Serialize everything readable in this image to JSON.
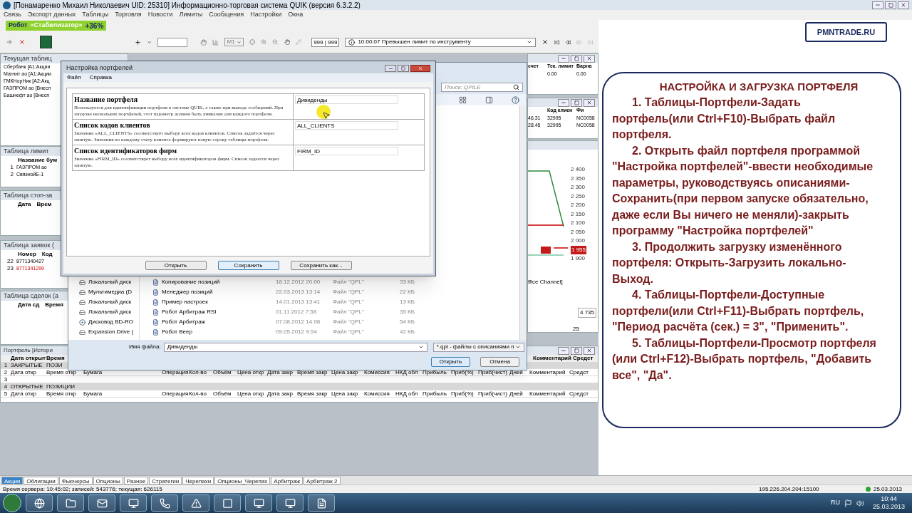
{
  "window": {
    "title": "[Понамаренко Михаил Николаевич  UID: 25310] Информационно-торговая система QUIK (версия 6.3.2.2)"
  },
  "menu": [
    "Связь",
    "Экспорт данных",
    "Таблицы",
    "Торговля",
    "Новости",
    "Лимиты",
    "Сообщения",
    "Настройки",
    "Окна"
  ],
  "robot_banner": {
    "label": "Робот",
    "name": "«Стабилизатор»",
    "gain": "+36%"
  },
  "toolbar": {
    "timeframe": "M1",
    "counter": "999 | 999",
    "message": "10:00:07  Превышен лимит по инструменту"
  },
  "site_badge": "PMNTRADE.RU",
  "instructions": {
    "title": "НАСТРОЙКА И ЗАГРУЗКА ПОРТФЕЛЯ",
    "steps": [
      "1. Таблицы-Портфели-Задать портфель(или Ctrl+F10)-Выбрать файл портфеля.",
      "2. Открыть файл портфеля программой \"Настройка портфелей\"-ввести необходимые параметры, руководствуясь описаниями- Сохранить(при первом запуске обязательно, даже если Вы ничего не меняли)-закрыть программу \"Настройка портфелей\"",
      "3. Продолжить загрузку изменённого портфеля: Открыть-Загрузить локально-Выход.",
      "4. Таблицы-Портфели-Доступные портфели(или Ctrl+F11)-Выбрать портфель, \"Период расчёта (сек.) = 3\", \"Применить\".",
      "5. Таблицы-Портфели-Просмотр портфеля (или Ctrl+F12)-Выбрать портфель, \"Добавить все\", \"Да\"."
    ]
  },
  "left_windows": [
    {
      "title": "Текущая таблиц",
      "rows": [
        {
          "cells": [
            "Сбербанк [A1:Акции"
          ],
          "alert": false
        },
        {
          "cells": [
            "Магнит ао [A1:Акции"
          ],
          "alert": false
        },
        {
          "cells": [
            "ГМКНорНик [A2:Акц"
          ],
          "alert": false
        },
        {
          "cells": [
            "ГАЗПРОМ ао [Внесп"
          ],
          "alert": false
        },
        {
          "cells": [
            "Башнефт ао [Внесп"
          ],
          "alert": false
        }
      ]
    },
    {
      "title": "Таблица лимит",
      "columns": [
        "Название бум"
      ],
      "rows": [
        {
          "num": "1",
          "cells": [
            "ГАЗПРОМ ао"
          ],
          "alert": false
        },
        {
          "num": "2",
          "cells": [
            "СвязнойБ-1"
          ],
          "alert": false
        }
      ]
    },
    {
      "title": "Таблица стоп-за",
      "columns": [
        "Дата",
        "Врем"
      ]
    },
    {
      "title": "Таблица заявок (",
      "columns": [
        "Номер",
        "Код"
      ],
      "rows": [
        {
          "num": "22",
          "cells": [
            "8771340427"
          ],
          "alert": false
        },
        {
          "num": "23",
          "cells": [
            "8771341299"
          ],
          "alert": true
        }
      ]
    },
    {
      "title": "Таблица сделок (а",
      "columns": [
        "Дата сд",
        "Время"
      ]
    }
  ],
  "right_windows": [
    {
      "columns": [
        "счет",
        "Тек. лимит",
        "Варна"
      ],
      "rows": [
        [
          "",
          "0.00",
          "0.00"
        ]
      ]
    },
    {
      "columns": [
        "",
        "Код клиен",
        "Фи"
      ],
      "rows": [
        [
          "46.31",
          "32995",
          "NC0058"
        ],
        [
          "28.45",
          "32995",
          "NC0058"
        ]
      ]
    }
  ],
  "price_chart": {
    "scale": [
      {
        "label": "2 400",
        "current": false
      },
      {
        "label": "2 350",
        "current": false
      },
      {
        "label": "2 300",
        "current": false
      },
      {
        "label": "2 250",
        "current": false
      },
      {
        "label": "2 200",
        "current": false
      },
      {
        "label": "2 150",
        "current": false
      },
      {
        "label": "2 100",
        "current": false
      },
      {
        "label": "2 050",
        "current": false
      },
      {
        "label": "2 000",
        "current": false
      },
      {
        "label": "1 955",
        "current": true
      },
      {
        "label": "1 900",
        "current": false
      }
    ],
    "caption": "ffice Channel]",
    "reading": "4 735",
    "count": "25"
  },
  "file_dialog": {
    "search_placeholder": "Поиск: QPILE",
    "nav": [
      "Локальный диск",
      "Мультимедиа (D",
      "Локальный диск",
      "Локальный диск",
      "Дисковод BD-RO",
      "Expansion Drive ("
    ],
    "files": [
      {
        "name": "Копирование позиций",
        "date": "18.12.2012 20:00",
        "type": "Файл \"QPL\"",
        "size": "33 КБ"
      },
      {
        "name": "Менеджер позиций",
        "date": "22.03.2013 13:14",
        "type": "Файл \"QPL\"",
        "size": "22 КБ"
      },
      {
        "name": "Пример настроек",
        "date": "14.01.2013 13:41",
        "type": "Файл \"QPL\"",
        "size": "13 КБ"
      },
      {
        "name": "Робот Арбитраж RSI",
        "date": "01.11.2012 7:58",
        "type": "Файл \"QPL\"",
        "size": "35 КБ"
      },
      {
        "name": "Робот Арбитраж",
        "date": "07.08.2012 14:08",
        "type": "Файл \"QPL\"",
        "size": "54 КБ"
      },
      {
        "name": "Робот Веер",
        "date": "09.05.2012 9:54",
        "type": "Файл \"QPL\"",
        "size": "42 КБ"
      }
    ],
    "filename_label": "Имя файла:",
    "filename": "Дивиденды",
    "filter": "*.qpl - файлы с описаниями п",
    "buttons": [
      {
        "label": "Открыть",
        "default": true
      },
      {
        "label": "Отмена",
        "default": false
      }
    ]
  },
  "settings_dialog": {
    "title": "Настройка портфелей",
    "menu": [
      "Файл",
      "Справка"
    ],
    "params": [
      {
        "name": "Название портфеля",
        "description": "Используется для идентификации портфеля в системе QUIK, а также при выводе сообщений. При загрузке нескольких портфелей, этот параметр должен быть уникален для каждого портфеля.",
        "value": "Дивиденды"
      },
      {
        "name": "Список кодов клиентов",
        "description": "Значение «ALL_CLIENTS» соответствует выбору всех кодов клиентов. Список задаётся через запятую. Значения по каждому счету клиента формируют новую строку таблицы портфеля.",
        "value": "ALL_CLIENTS"
      },
      {
        "name": "Список идентификаторов фирм",
        "description": "Значение «FIRM_ID» соответствует выбору всех идентификаторов фирм. Список задается через запятую.",
        "value": "FIRM_ID"
      }
    ],
    "buttons": [
      {
        "label": "Открыть",
        "default": false
      },
      {
        "label": "Сохранить",
        "default": true
      },
      {
        "label": "Сохранить как...",
        "default": false
      }
    ]
  },
  "portfolio": {
    "title": "Портфель [Истори",
    "header_left": [
      "Дата открыт",
      "Время"
    ],
    "header_right": [
      "Комментарий",
      "Средст"
    ],
    "rows": [
      {
        "num": "1",
        "kind": "section",
        "cells": [
          "ЗАКРЫТЫЕ",
          "ПОЗИ"
        ]
      },
      {
        "num": "2",
        "kind": "columns",
        "cells": [
          "Дата откр",
          "Время откр",
          "Бумага",
          "Операция",
          "Кол-во",
          "Объём",
          "Цена откр",
          "Дата закр",
          "Время закр",
          "Цена закр",
          "Комиссия",
          "НКД обл",
          "Прибыль",
          "Приб(%)",
          "Приб(чист)",
          "Дней",
          "Комментарий",
          "Средст"
        ]
      },
      {
        "num": "3",
        "kind": "blank"
      },
      {
        "num": "4",
        "kind": "section",
        "cells": [
          "ОТКРЫТЫЕ",
          "ПОЗИЦИИ"
        ]
      },
      {
        "num": "5",
        "kind": "columns",
        "cells": [
          "Дата откр",
          "Время откр",
          "Бумага",
          "Операция",
          "Кол-во",
          "Объём",
          "Цена откр",
          "Дата закр",
          "Время закр",
          "Цена закр",
          "Комиссия",
          "НКД обл",
          "Прибыль",
          "Приб(%)",
          "Приб(чист)",
          "Дней",
          "Комментарий",
          "Средст"
        ]
      }
    ]
  },
  "tabs": [
    {
      "label": "Акции",
      "selected": true
    },
    {
      "label": "Облигации",
      "selected": false
    },
    {
      "label": "Фьючерсы",
      "selected": false
    },
    {
      "label": "Опционы",
      "selected": false
    },
    {
      "label": "Разное",
      "selected": false
    },
    {
      "label": "Стратегии",
      "selected": false
    },
    {
      "label": "Черепахи",
      "selected": false
    },
    {
      "label": "Опционы_Черепах",
      "selected": false
    },
    {
      "label": "Арбитраж",
      "selected": false
    },
    {
      "label": "Арбитраж 2",
      "selected": false
    }
  ],
  "status_bar": {
    "text": "Время сервера: 10:45:02; записей: 543776; текущая: 626115",
    "server": "195.226.204.204:15100",
    "date": "25.03.2013"
  },
  "taskbar": {
    "language": "RU",
    "time": "10:44",
    "date": "25.03.2013"
  }
}
